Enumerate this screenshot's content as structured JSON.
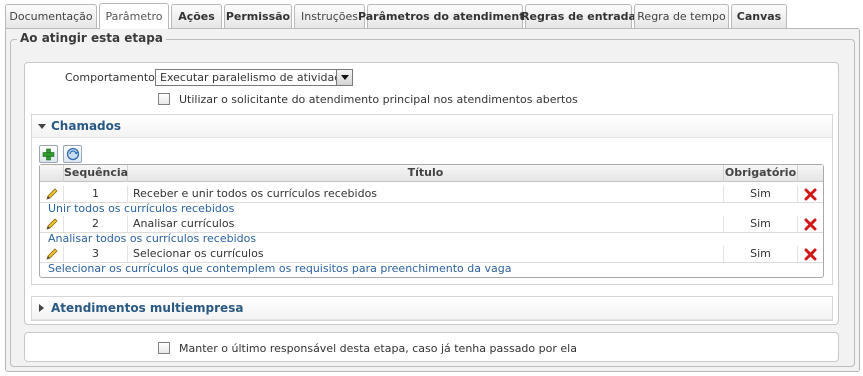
{
  "tabs": [
    {
      "label": "Documentação",
      "bold": false
    },
    {
      "label": "Parâmetro",
      "bold": false,
      "active": true
    },
    {
      "label": "Ações",
      "bold": true
    },
    {
      "label": "Permissão",
      "bold": true
    },
    {
      "label": "Instruções",
      "bold": false
    },
    {
      "label": "Parâmetros do atendimento",
      "bold": true
    },
    {
      "label": "Regras de entrada",
      "bold": true
    },
    {
      "label": "Regra de tempo",
      "bold": false
    },
    {
      "label": "Canvas",
      "bold": true
    }
  ],
  "form": {
    "legend": "Ao atingir esta etapa",
    "behavior_label": "Comportamento :",
    "behavior_value": "Executar paralelismo de atividades",
    "requester_checkbox_label": "Utilizar o solicitante do atendimento principal nos atendimentos abertos",
    "requester_checked": false,
    "keep_responsible_label": "Manter o último responsável desta etapa, caso já tenha passado por ela",
    "keep_responsible_checked": false
  },
  "calls_panel": {
    "title": "Chamados",
    "expanded": true,
    "toolbar": {
      "add_icon": "plus-icon",
      "refresh_icon": "refresh-icon"
    },
    "columns": {
      "sequence": "Sequência",
      "title": "Título",
      "required": "Obrigatório"
    },
    "rows": [
      {
        "sequence": "1",
        "title": "Receber e unir todos os currículos recebidos",
        "required": "Sim",
        "description": "Unir todos os currículos recebidos"
      },
      {
        "sequence": "2",
        "title": "Analisar currículos",
        "required": "Sim",
        "description": "Analisar todos os currículos recebidos"
      },
      {
        "sequence": "3",
        "title": "Selecionar os currículos",
        "required": "Sim",
        "description": "Selecionar os currículos que contemplem os requisitos para preenchimento da vaga"
      }
    ]
  },
  "multi_company_panel": {
    "title": "Atendimentos multiempresa",
    "expanded": false
  },
  "colors": {
    "panel_title": "#2a5a84",
    "link_text": "#2b62a0",
    "delete_icon": "#d01818",
    "add_icon": "#2f9a2f"
  }
}
